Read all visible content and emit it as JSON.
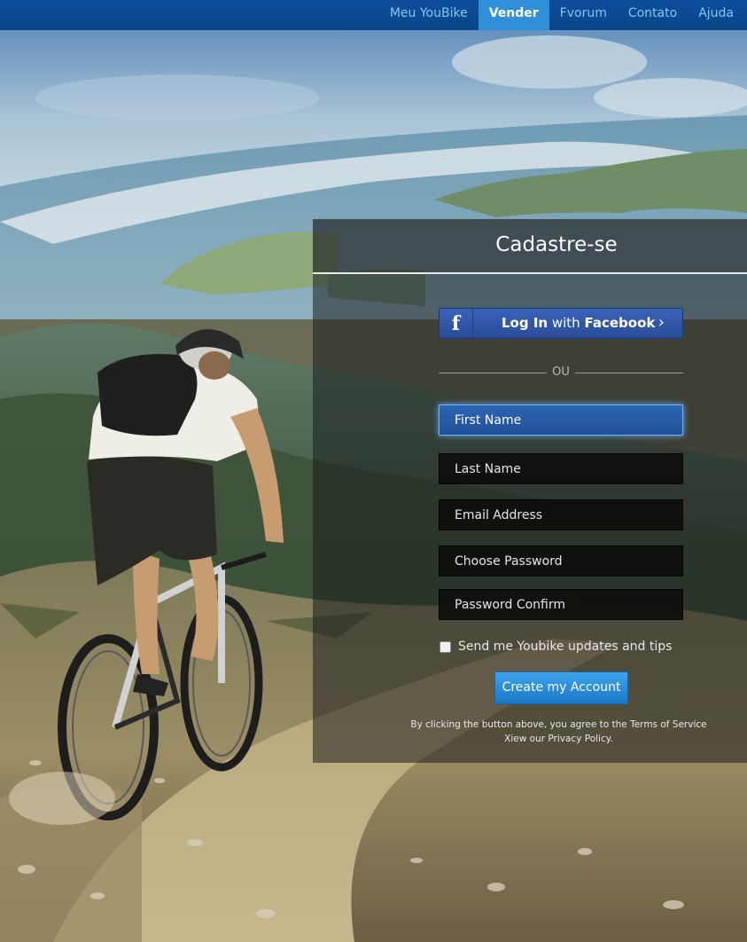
{
  "colors": {
    "nav_bar": "#0b4a92",
    "nav_active": "#2f8fd8",
    "nav_text": "#8fc0f0",
    "facebook": "#3458a8",
    "focused_field": "#2560aa",
    "create_button": "#2a8ad8"
  },
  "nav": {
    "items": [
      {
        "label": "Meu YouBike",
        "active": false
      },
      {
        "label": "Vender",
        "active": true
      },
      {
        "label": "Fvorum",
        "active": false
      },
      {
        "label": "Contato",
        "active": false
      },
      {
        "label": "Ajuda",
        "active": false
      }
    ]
  },
  "signup": {
    "title": "Cadastre-se",
    "facebook": {
      "icon": "facebook-f-icon",
      "text_prefix": "Log In",
      "text_middle": " with ",
      "text_brand": "Facebook",
      "arrow": "›"
    },
    "divider_text": "OU",
    "fields": {
      "first_name": {
        "placeholder": "First Name",
        "focused": true
      },
      "last_name": {
        "placeholder": "Last Name"
      },
      "email": {
        "placeholder": "Email Address"
      },
      "password": {
        "placeholder": "Choose Password"
      },
      "password_confirm": {
        "placeholder": "Password Confirm"
      }
    },
    "updates_checkbox": {
      "label": "Send me Youbike updates and tips",
      "checked": false
    },
    "create_button": "Create my Account",
    "terms_line1_prefix": "By clicking the button above, you agree to the ",
    "terms_line1_link": "Terms of Service",
    "terms_line2_prefix": "Xiew our ",
    "terms_line2_link": "Privacy Policy",
    "terms_line2_suffix": "."
  }
}
